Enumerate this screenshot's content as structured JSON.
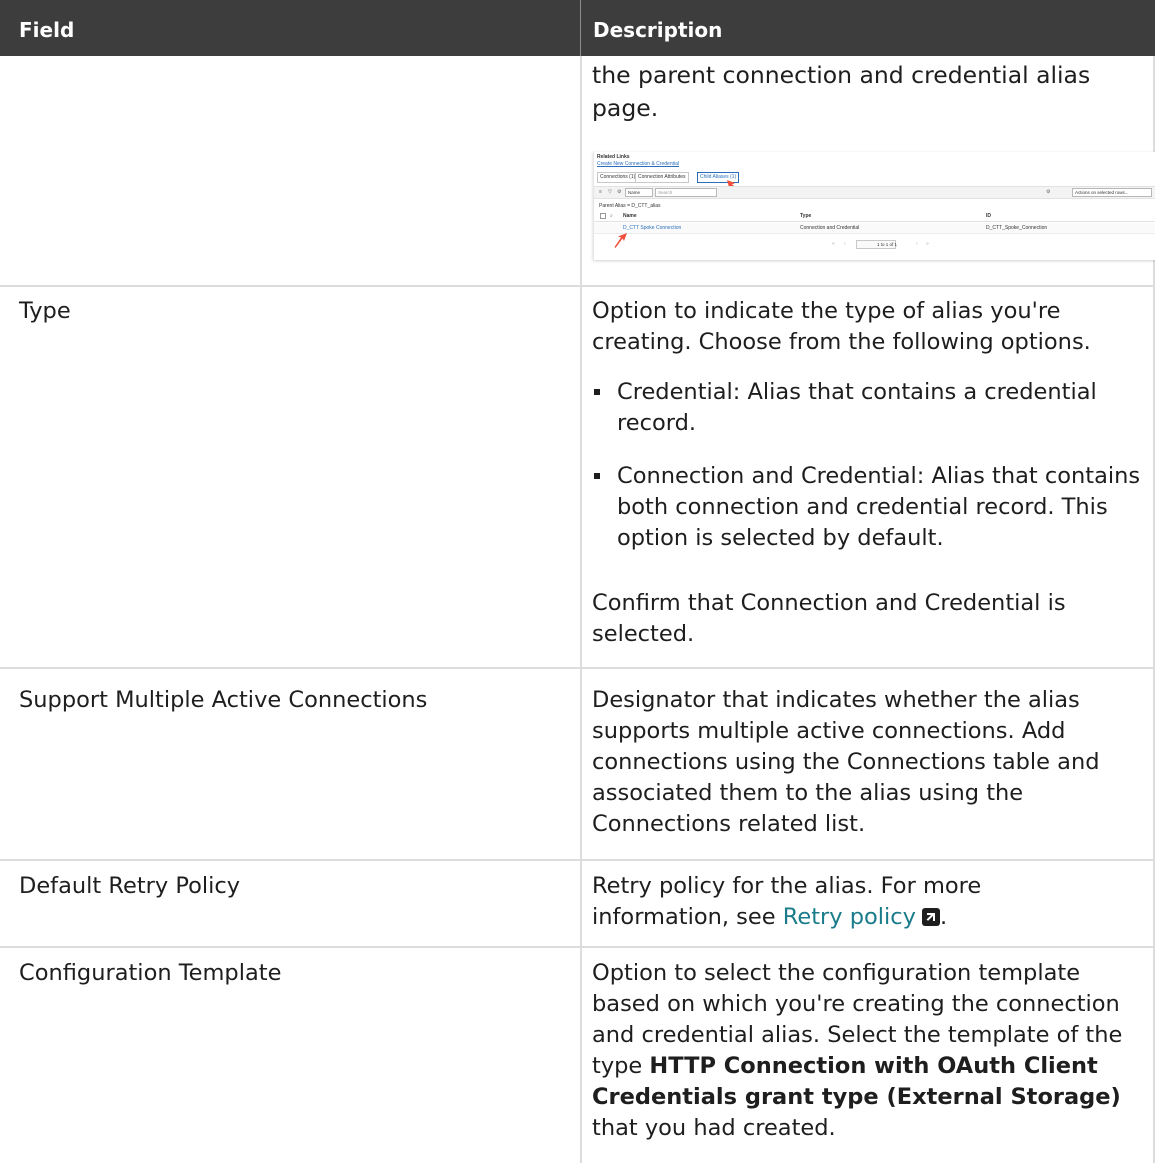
{
  "table": {
    "headers": {
      "field": "Field",
      "description": "Description"
    }
  },
  "rows": {
    "intro": {
      "description": "the parent connection and credential alias page."
    },
    "screenshot": {
      "related_links_title": "Related Links",
      "create_link": "Create New Connection & Credential",
      "tabs": [
        "Connections (1)",
        "Connection Attributes",
        "Child Aliases (1)"
      ],
      "filter_field": "Name",
      "search_placeholder": "Search",
      "actions_select": "Actions on selected rows...",
      "breadcrumb": "Parent Alias = D_CTT_alias",
      "columns": [
        "Name",
        "Type",
        "ID"
      ],
      "row": {
        "name": "D_CTT Spoke Connection",
        "type": "Connection and Credential",
        "id": "D_CTT_Spoke_Connection"
      },
      "pager_page": "1",
      "pager_text": "to 1 of 1",
      "highlight_color": "#f0503c"
    },
    "type": {
      "field": "Type",
      "description": "Option to indicate the type of alias you're creating. Choose from the following options.",
      "bullets": [
        "Credential: Alias that contains a credential record.",
        "Connection and Credential: Alias that contains both connection and credential record. This option is selected by default."
      ],
      "note": "Confirm that Connection and Credential is selected."
    },
    "multiple": {
      "field": "Support Multiple Active Connections",
      "description": "Designator that indicates whether the alias supports multiple active connections. Add connections using the Connections table and associated them to the alias using the Connections related list."
    },
    "retry": {
      "field": "Default Retry Policy",
      "description_prefix": "Retry policy for the alias. For more information, see ",
      "link_text": "Retry policy",
      "description_suffix": ".",
      "link_color": "#1a7c8a"
    },
    "config": {
      "field": "Configuration Template",
      "description_prefix": "Option to select the configuration template based on which you're creating the connection and credential alias. Select the template of the type ",
      "bold_text": "HTTP Connection with OAuth Client Credentials grant type (External Storage)",
      "description_suffix": " that you had created."
    }
  },
  "colors": {
    "header_bg": "#3d3d3d",
    "header_text": "#ffffff",
    "grid_line": "#dcdcdc"
  }
}
